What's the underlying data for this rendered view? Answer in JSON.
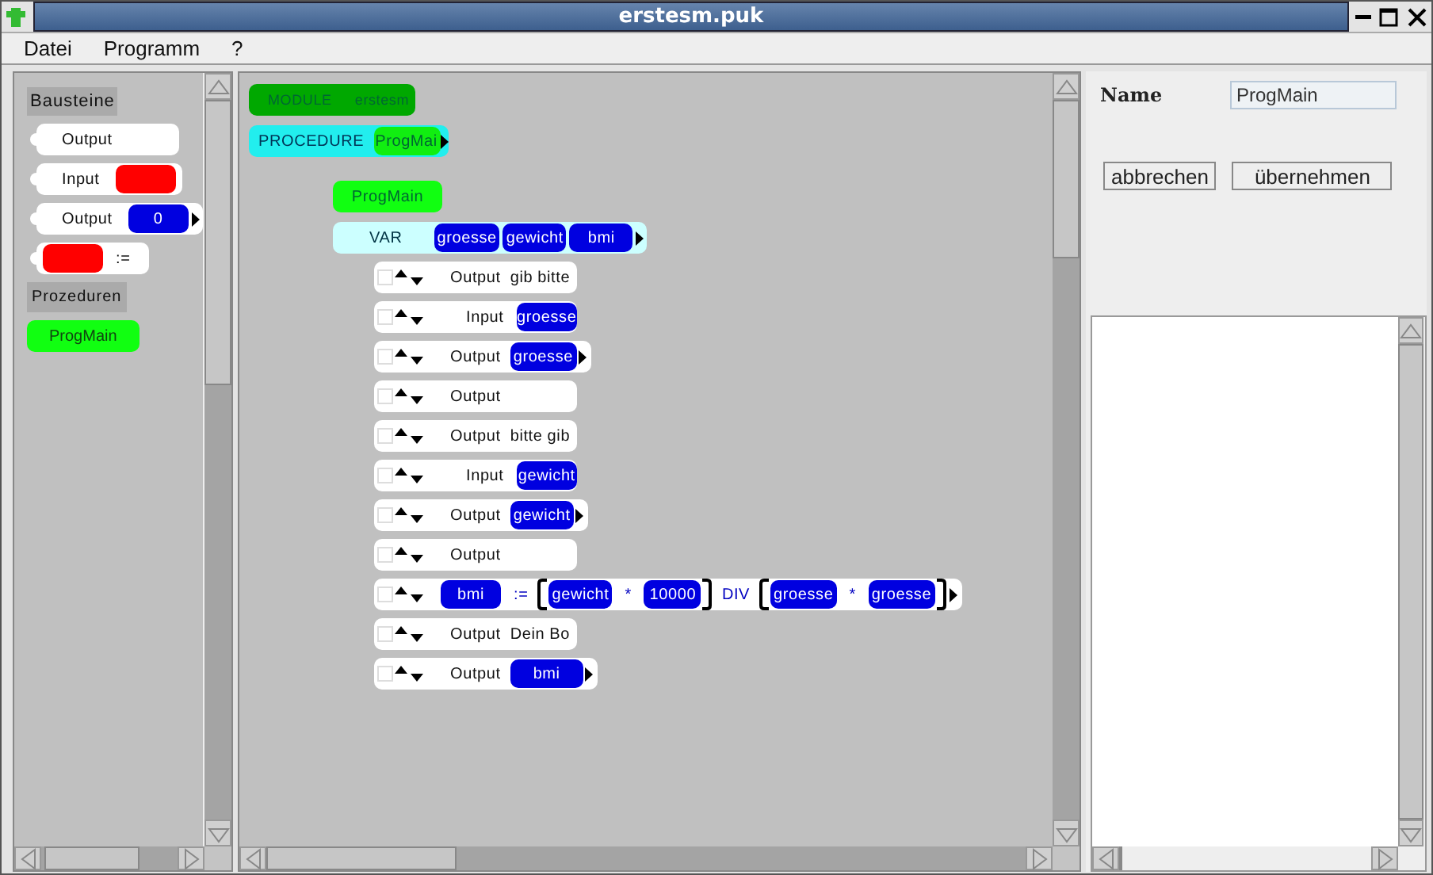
{
  "window": {
    "title": "erstesm.puk"
  },
  "menu": [
    "Datei",
    "Programm",
    "?"
  ],
  "palette": {
    "heading": "Bausteine",
    "procedures_heading": "Prozeduren",
    "blocks": [
      {
        "kind": "output",
        "label": "Output"
      },
      {
        "kind": "input",
        "label": "Input"
      },
      {
        "kind": "output_value",
        "label": "Output",
        "value": "0"
      },
      {
        "kind": "assign",
        "label": ":="
      }
    ],
    "procedures": [
      "ProgMain"
    ]
  },
  "canvas": {
    "module": {
      "keyword": "MODULE",
      "name": "erstesm"
    },
    "procedure": {
      "keyword": "PROCEDURE",
      "name": "ProgMai"
    },
    "proc_name": "ProgMain",
    "var": {
      "keyword": "VAR",
      "variables": [
        "groesse",
        "gewicht",
        "bmi"
      ]
    },
    "statements": [
      {
        "kind": "output",
        "label": "Output",
        "text": "gib bitte"
      },
      {
        "kind": "input",
        "label": "Input",
        "var": "groesse"
      },
      {
        "kind": "output_var",
        "label": "Output",
        "var": "groesse"
      },
      {
        "kind": "output",
        "label": "Output"
      },
      {
        "kind": "output",
        "label": "Output",
        "text": "bitte gib"
      },
      {
        "kind": "input",
        "label": "Input",
        "var": "gewicht"
      },
      {
        "kind": "output_var",
        "label": "Output",
        "var": "gewicht"
      },
      {
        "kind": "output",
        "label": "Output"
      },
      {
        "kind": "assign",
        "target": "bmi",
        "op": ":=",
        "expr": [
          {
            "kind": "group",
            "items": [
              {
                "kind": "var",
                "text": "gewicht"
              },
              {
                "kind": "op",
                "text": "*"
              },
              {
                "kind": "var",
                "text": "10000"
              }
            ]
          },
          {
            "kind": "op",
            "text": "DIV"
          },
          {
            "kind": "group",
            "items": [
              {
                "kind": "var",
                "text": "groesse"
              },
              {
                "kind": "op",
                "text": "*"
              },
              {
                "kind": "var",
                "text": "groesse"
              }
            ]
          }
        ]
      },
      {
        "kind": "output",
        "label": "Output",
        "text": "Dein Bo"
      },
      {
        "kind": "output_var",
        "label": "Output",
        "var": "bmi"
      }
    ]
  },
  "properties": {
    "name_label": "Name",
    "name_value": "ProgMain",
    "buttons": [
      "abbrechen",
      "übernehmen"
    ]
  }
}
